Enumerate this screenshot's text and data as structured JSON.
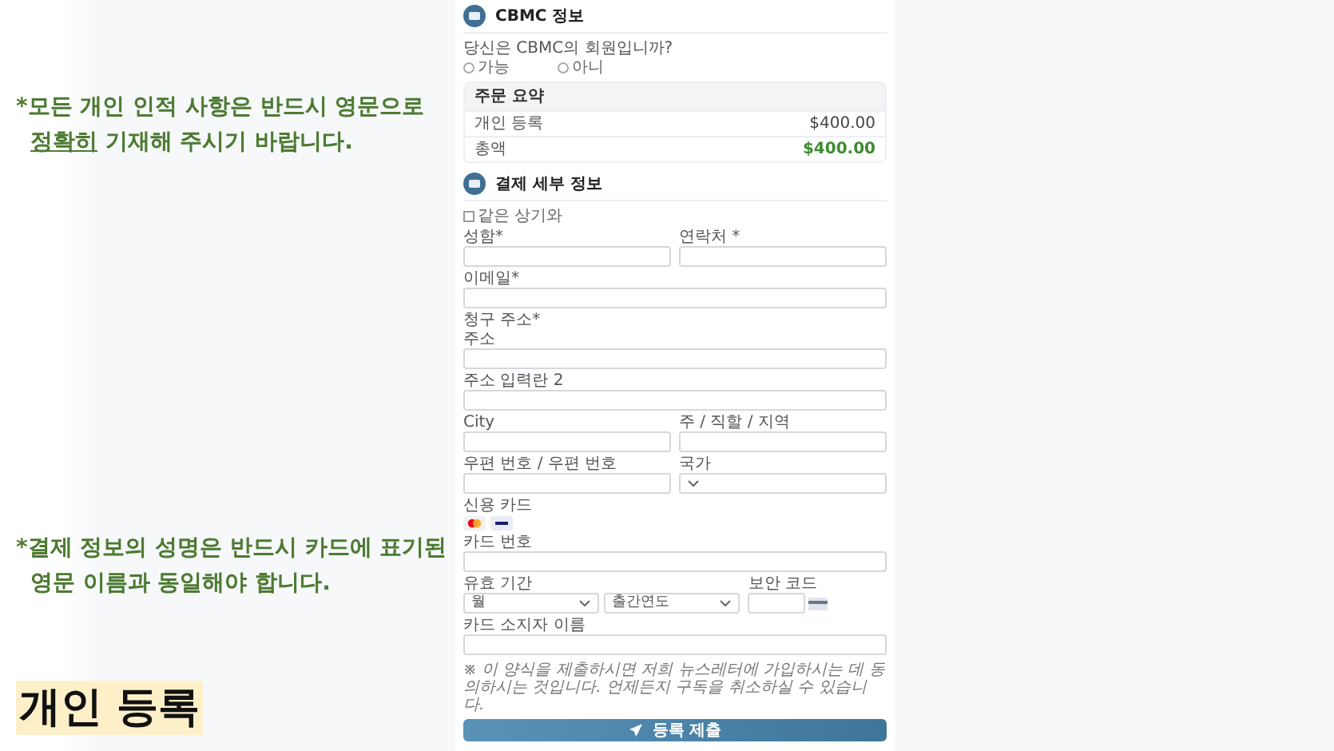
{
  "notes": [
    {
      "kind": "top",
      "lines": [
        [
          {
            "text": "*모든 개인 인적 사항은 반드시 영문으로",
            "underline": false
          }
        ],
        [
          {
            "text": "정확히",
            "underline": true
          },
          {
            "text": " 기재해 주시기 바랍니다.",
            "underline": false
          }
        ]
      ]
    },
    {
      "kind": "bottom",
      "lines": [
        [
          {
            "text": "*결제 정보의 성명은 반드시 카드에 표기된",
            "underline": false
          }
        ],
        [
          {
            "text": "영문 이름과 동일해야 합니다.",
            "underline": false
          }
        ]
      ]
    }
  ],
  "page_title": "개인 등록",
  "cbmc": {
    "title": "CBMC 정보",
    "question": "당신은 CBMC의 회원입니까?",
    "options": [
      {
        "label": "가능",
        "selected": false
      },
      {
        "label": "아니",
        "selected": false
      }
    ]
  },
  "order_summary": {
    "title": "주문 요약",
    "rows": [
      {
        "label": "개인 등록",
        "amount": "$400.00",
        "kind": "item"
      },
      {
        "label": "총액",
        "amount": "$400.00",
        "kind": "total"
      }
    ]
  },
  "payment": {
    "title": "결제 세부 정보",
    "same_as_above": {
      "label": "같은 상기와",
      "checked": false
    },
    "rows": [
      [
        {
          "kind": "text",
          "label": "성함*"
        },
        {
          "kind": "text",
          "label": "연락처 *"
        }
      ],
      [
        {
          "kind": "text",
          "label": "이메일*"
        }
      ],
      [
        {
          "kind": "heading",
          "label": "청구 주소*"
        }
      ],
      [
        {
          "kind": "text",
          "label": "주소"
        }
      ],
      [
        {
          "kind": "text",
          "label": "주소 입력란 2"
        }
      ],
      [
        {
          "kind": "text",
          "label": "City"
        },
        {
          "kind": "text",
          "label": "주 / 직할 / 지역"
        }
      ],
      [
        {
          "kind": "text",
          "label": "우편 번호 / 우편 번호"
        },
        {
          "kind": "select",
          "label": "국가"
        }
      ]
    ]
  },
  "card": {
    "label": "신용 카드",
    "number_label": "카드 번호",
    "expiry_label": "유효 기간",
    "month": "월",
    "year": "출간연도",
    "cvc_label": "보안 코드",
    "holder_label": "카드 소지자 이름"
  },
  "fine_print": "※ 이 양식을 제출하시면 저희 뉴스레터에 가입하시는 데 동의하시는 것입니다. 언제든지 구독을 취소하실 수 있습니다.",
  "submit": "등록 제출"
}
